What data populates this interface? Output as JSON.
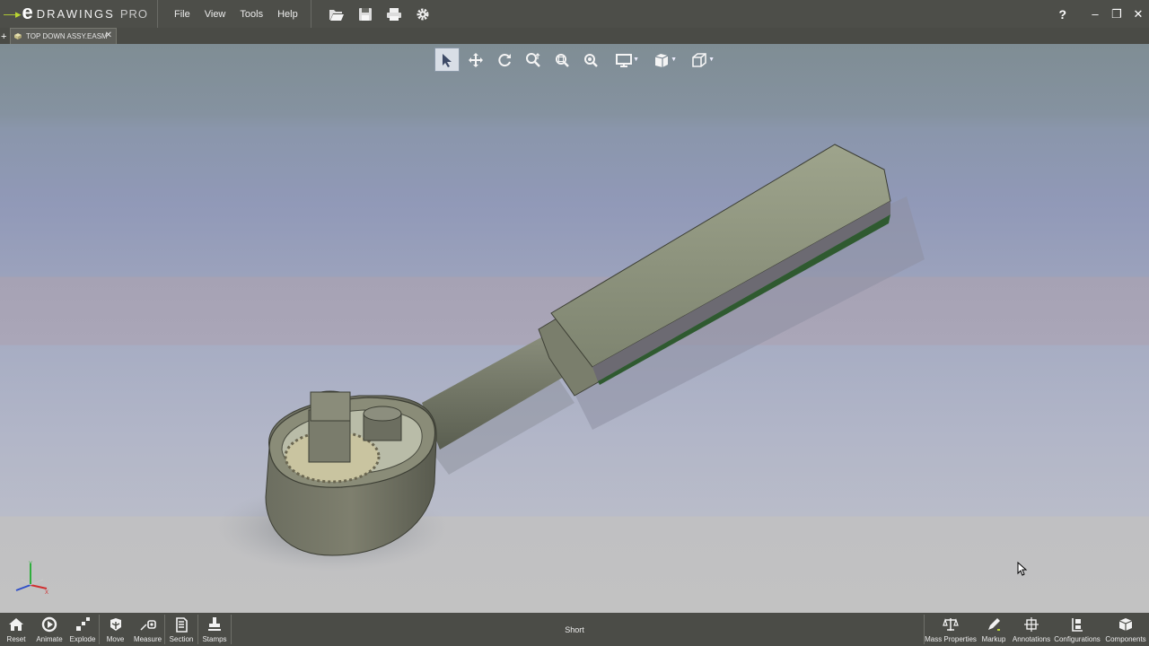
{
  "app": {
    "title_prefix": "DRAWINGS",
    "edition": "PRO",
    "logo_letter": "e"
  },
  "menu": {
    "file": "File",
    "view": "View",
    "tools": "Tools",
    "help": "Help"
  },
  "quick_access": [
    "open-icon",
    "save-icon",
    "print-icon",
    "settings-icon"
  ],
  "window": {
    "help": "?",
    "minimize": "–",
    "restore": "❐",
    "close": "✕"
  },
  "tabs": {
    "add": "+",
    "document": "TOP DOWN ASSY.EASM",
    "close": "✕"
  },
  "view_toolbar": [
    "select-icon",
    "pan-icon",
    "rotate-icon",
    "zoom-icon",
    "zoom-to-fit-icon",
    "zoom-to-area-icon",
    "display-style-icon",
    "view-orientation-icon",
    "section-view-icon"
  ],
  "bottom": {
    "status": "Short",
    "left_tools": [
      {
        "label": "Reset",
        "icon": "home-icon"
      },
      {
        "label": "Animate",
        "icon": "animate-icon"
      },
      {
        "label": "Explode",
        "icon": "explode-icon"
      },
      {
        "label": "Move",
        "icon": "move-icon"
      },
      {
        "label": "Measure",
        "icon": "measure-icon"
      },
      {
        "label": "Section",
        "icon": "section-icon"
      },
      {
        "label": "Stamps",
        "icon": "stamp-icon"
      }
    ],
    "right_tools": [
      {
        "label": "Mass Properties",
        "icon": "scale-icon"
      },
      {
        "label": "Markup",
        "icon": "pencil-icon"
      },
      {
        "label": "Annotations",
        "icon": "annotations-icon"
      },
      {
        "label": "Configurations",
        "icon": "configurations-icon"
      },
      {
        "label": "Components",
        "icon": "components-icon"
      }
    ]
  },
  "colors": {
    "chrome": "#4d4e49",
    "accent": "#b8d432",
    "model_body": "#6f7464"
  }
}
